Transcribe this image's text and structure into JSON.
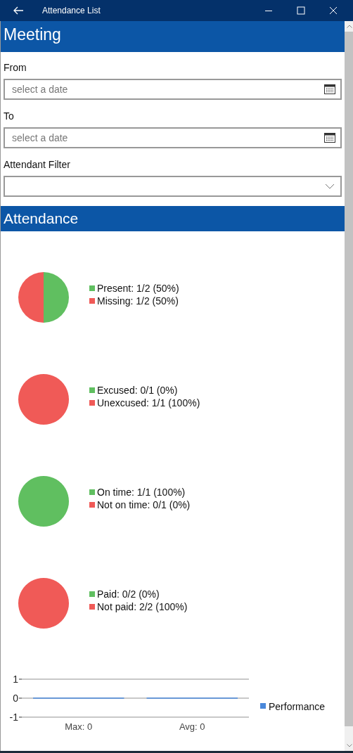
{
  "window": {
    "title": "Attendance List"
  },
  "meeting": {
    "heading": "Meeting",
    "filters": [
      {
        "kind": "date",
        "label": "From",
        "placeholder": "select a date"
      },
      {
        "kind": "date",
        "label": "To",
        "placeholder": "select a date"
      },
      {
        "kind": "dropdown",
        "label": "Attendant Filter"
      }
    ]
  },
  "attendance": {
    "heading": "Attendance",
    "pies": [
      {
        "chart_data": {
          "type": "pie",
          "categories": [
            "Present: 1/2 (50%)",
            "Missing: 1/2 (50%)"
          ],
          "values": [
            1,
            1
          ],
          "colors": [
            "#60bf60",
            "#f05a57"
          ]
        }
      },
      {
        "chart_data": {
          "type": "pie",
          "categories": [
            "Excused: 0/1 (0%)",
            "Unexcused: 1/1 (100%)"
          ],
          "values": [
            0,
            1
          ],
          "colors": [
            "#60bf60",
            "#f05a57"
          ]
        }
      },
      {
        "chart_data": {
          "type": "pie",
          "categories": [
            "On time: 1/1 (100%)",
            "Not on time: 0/1 (0%)"
          ],
          "values": [
            1,
            0
          ],
          "colors": [
            "#60bf60",
            "#f05a57"
          ]
        }
      },
      {
        "chart_data": {
          "type": "pie",
          "categories": [
            "Paid: 0/2 (0%)",
            "Not paid: 2/2 (100%)"
          ],
          "values": [
            0,
            2
          ],
          "colors": [
            "#60bf60",
            "#f05a57"
          ]
        }
      }
    ],
    "performance": {
      "chart_data": {
        "type": "bar",
        "categories": [
          "Max: 0",
          "Avg: 0"
        ],
        "series": [
          {
            "name": "Performance",
            "color": "#4a88da",
            "values": [
              0,
              0
            ]
          }
        ],
        "ylim": [
          -1,
          1
        ],
        "yticks": [
          -1,
          0,
          1
        ]
      }
    }
  }
}
